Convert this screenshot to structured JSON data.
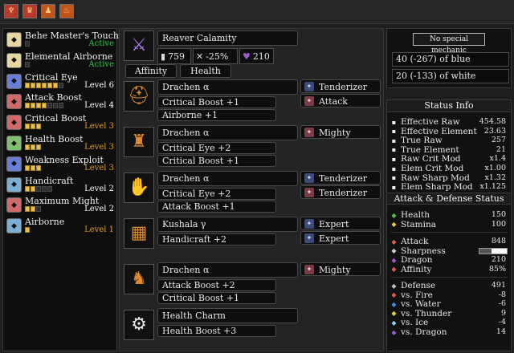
{
  "topbar": {
    "buttons": [
      {
        "icon": "talisman-icon",
        "glyph": "♆"
      },
      {
        "icon": "crown-icon",
        "glyph": "♛"
      },
      {
        "icon": "figure-icon",
        "glyph": "♟"
      },
      {
        "icon": "bowl-icon",
        "glyph": "♨"
      }
    ]
  },
  "skills": [
    {
      "name": "Behe Master's Touch",
      "level": "Active",
      "pips": 1,
      "filled": 0,
      "color": "#34c24a",
      "icon_bg": "#e8d6a0",
      "icon": "set-bonus-icon"
    },
    {
      "name": "Elemental Airborne",
      "level": "Active",
      "pips": 1,
      "filled": 0,
      "color": "#34c24a",
      "icon_bg": "#e8d6a0",
      "icon": "set-bonus-icon"
    },
    {
      "name": "Critical Eye",
      "level": "Level 6",
      "pips": 7,
      "filled": 6,
      "color": "#ffffff",
      "icon_bg": "#6a7ed8",
      "icon": "eye-skill-icon"
    },
    {
      "name": "Attack Boost",
      "level": "Level 4",
      "pips": 7,
      "filled": 4,
      "color": "#ffffff",
      "icon_bg": "#d06a6a",
      "icon": "attack-skill-icon"
    },
    {
      "name": "Critical Boost",
      "level": "Level 3",
      "pips": 3,
      "filled": 3,
      "color": "#e09c2a",
      "icon_bg": "#d06a6a",
      "icon": "crit-skill-icon"
    },
    {
      "name": "Health Boost",
      "level": "Level 3",
      "pips": 3,
      "filled": 3,
      "color": "#e09c2a",
      "icon_bg": "#7ec070",
      "icon": "health-skill-icon"
    },
    {
      "name": "Weakness Exploit",
      "level": "Level 3",
      "pips": 3,
      "filled": 3,
      "color": "#e09c2a",
      "icon_bg": "#6a7ed8",
      "icon": "weakness-skill-icon"
    },
    {
      "name": "Handicraft",
      "level": "Level 2",
      "pips": 5,
      "filled": 2,
      "color": "#ffffff",
      "icon_bg": "#7ab0d8",
      "icon": "handicraft-skill-icon"
    },
    {
      "name": "Maximum Might",
      "level": "Level 2",
      "pips": 3,
      "filled": 2,
      "color": "#ffffff",
      "icon_bg": "#d06a6a",
      "icon": "might-skill-icon"
    },
    {
      "name": "Airborne",
      "level": "Level 1",
      "pips": 1,
      "filled": 1,
      "color": "#e09c2a",
      "icon_bg": "#7ab0d8",
      "icon": "airborne-skill-icon"
    }
  ],
  "weapon": {
    "name": "Reaver Calamity",
    "attack": "759",
    "affinity": "-25%",
    "element": "210",
    "tabs": [
      "Affinity",
      "Health"
    ],
    "icon": "long-sword-icon"
  },
  "armor": [
    {
      "name": "Drachen α",
      "skills": [
        "Critical Boost +1",
        "Airborne +1"
      ],
      "decos": [
        {
          "name": "Tenderizer",
          "type": "b"
        },
        {
          "name": "Attack",
          "type": "r"
        }
      ],
      "icon": "helm-icon",
      "glyph": "⛑"
    },
    {
      "name": "Drachen α",
      "skills": [
        "Critical Eye +2",
        "Critical Boost +1"
      ],
      "decos": [
        {
          "name": "Mighty",
          "type": "r"
        }
      ],
      "icon": "chest-armor-icon",
      "glyph": "♜"
    },
    {
      "name": "Drachen α",
      "skills": [
        "Critical Eye +2",
        "Attack Boost +1"
      ],
      "decos": [
        {
          "name": "Tenderizer",
          "type": "b"
        },
        {
          "name": "Tenderizer",
          "type": "r"
        }
      ],
      "icon": "gauntlet-icon",
      "glyph": "✋"
    },
    {
      "name": "Kushala γ",
      "skills": [
        "Handicraft +2"
      ],
      "decos": [
        {
          "name": "Expert",
          "type": "b"
        },
        {
          "name": "Expert",
          "type": "b"
        }
      ],
      "icon": "waist-armor-icon",
      "glyph": "▦"
    },
    {
      "name": "Drachen α",
      "skills": [
        "Attack Boost +2",
        "Critical Boost +1"
      ],
      "decos": [
        {
          "name": "Mighty",
          "type": "r"
        }
      ],
      "icon": "leg-armor-icon",
      "glyph": "♞"
    },
    {
      "name": "Health Charm",
      "skills": [
        "Health Boost +3"
      ],
      "decos": [],
      "icon": "charm-icon",
      "glyph": "⚙"
    }
  ],
  "mechanic": {
    "button": "No special mechanic",
    "blue": "40 (-267) of blue",
    "white": "20 (-133) of white"
  },
  "status": {
    "title": "Status Info",
    "rows": [
      {
        "label": "Effective Raw",
        "value": "454.58",
        "icon": "raw-icon",
        "color": "#f0f0f0"
      },
      {
        "label": "Effective Element",
        "value": "23.63",
        "icon": "element-icon",
        "color": "#f0f0f0"
      },
      {
        "label": "True Raw",
        "value": "257",
        "icon": "raw-icon",
        "color": "#f0f0f0"
      },
      {
        "label": "True Element",
        "value": "21",
        "icon": "element-icon",
        "color": "#f0f0f0"
      },
      {
        "label": "Raw Crit Mod",
        "value": "x1.4",
        "icon": "crit-icon",
        "color": "#f0f0f0"
      },
      {
        "label": "Elem Crit Mod",
        "value": "x1.00",
        "icon": "crit-icon",
        "color": "#f0f0f0"
      },
      {
        "label": "Raw Sharp Mod",
        "value": "x1.32",
        "icon": "sharp-icon",
        "color": "#f0f0f0"
      },
      {
        "label": "Elem Sharp Mod",
        "value": "x1.125",
        "icon": "sharp-icon",
        "color": "#f0f0f0"
      }
    ]
  },
  "attack_defense": {
    "title": "Attack & Defense Status",
    "health": [
      {
        "label": "Health",
        "value": "150",
        "icon": "health-icon",
        "color": "#4ac24a"
      },
      {
        "label": "Stamina",
        "value": "100",
        "icon": "stamina-icon",
        "color": "#e8c14a"
      }
    ],
    "attack": [
      {
        "label": "Attack",
        "value": "848",
        "icon": "attack-icon",
        "color": "#e06050"
      },
      {
        "label": "Sharpness",
        "value": "",
        "icon": "sharpness-icon",
        "color": "#d0d0d0"
      },
      {
        "label": "Dragon",
        "value": "210",
        "icon": "dragon-icon",
        "color": "#9a5ac8"
      },
      {
        "label": "Affinity",
        "value": "85%",
        "icon": "affinity-icon",
        "color": "#e06050"
      }
    ],
    "sharpness_level": 0.45,
    "defense": [
      {
        "label": "Defense",
        "value": "491",
        "icon": "defense-icon",
        "color": "#c0c0c0"
      },
      {
        "label": "vs. Fire",
        "value": "-8",
        "icon": "fire-icon",
        "color": "#e06040"
      },
      {
        "label": "vs. Water",
        "value": "-6",
        "icon": "water-icon",
        "color": "#4a8ae0"
      },
      {
        "label": "vs. Thunder",
        "value": "9",
        "icon": "thunder-icon",
        "color": "#e8d040"
      },
      {
        "label": "vs. Ice",
        "value": "-4",
        "icon": "ice-icon",
        "color": "#90d0f0"
      },
      {
        "label": "vs. Dragon",
        "value": "14",
        "icon": "dragon-res-icon",
        "color": "#9a5ac8"
      }
    ]
  }
}
